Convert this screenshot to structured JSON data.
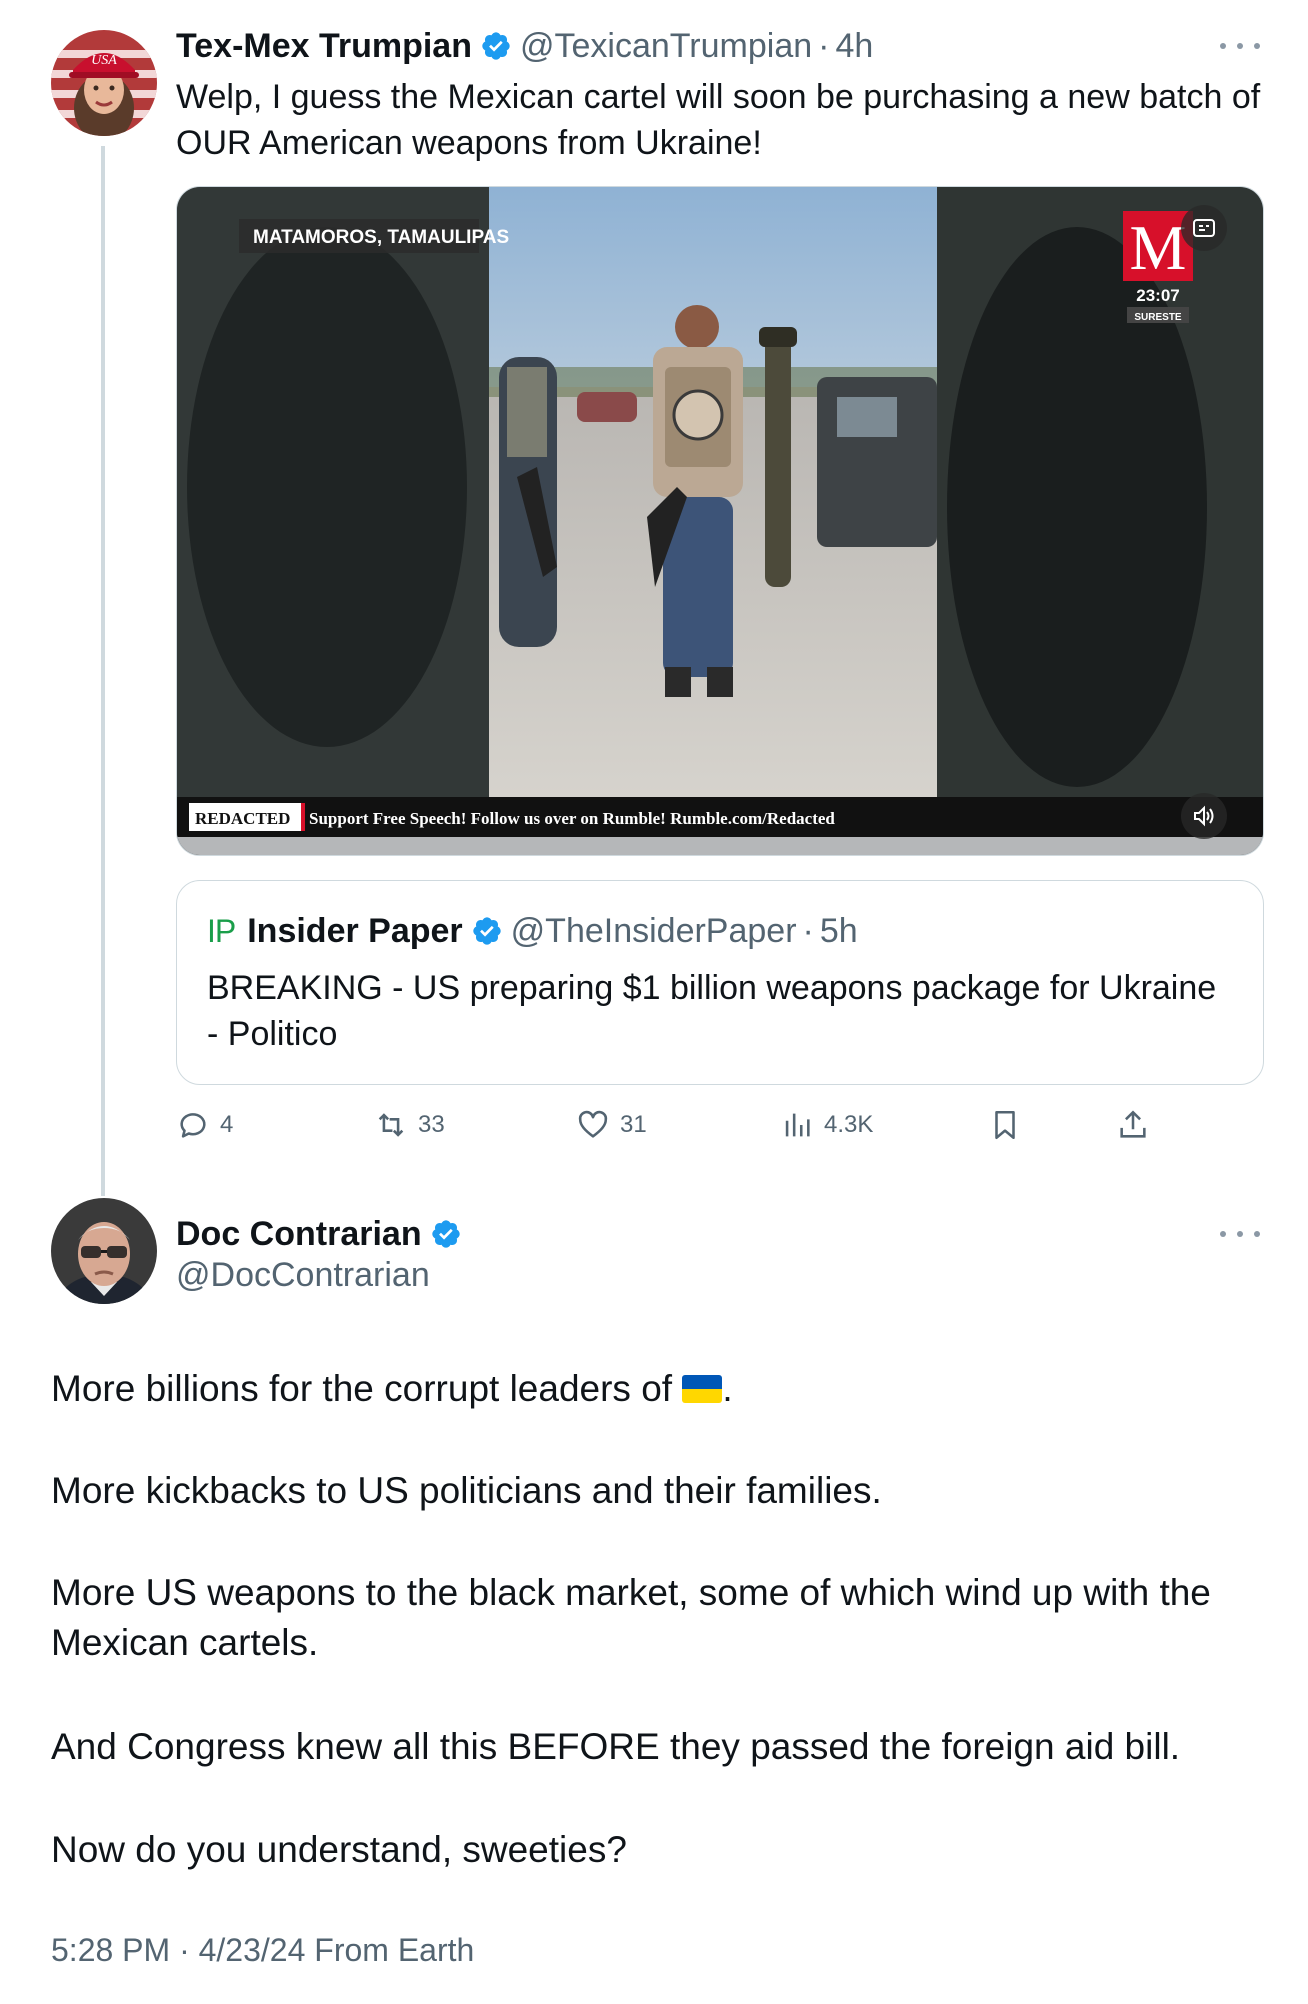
{
  "quoted_by": {
    "display_name": "Tex-Mex Trumpian",
    "handle": "@TexicanTrumpian",
    "separator": "·",
    "time": "4h",
    "text": "Welp, I guess the Mexican cartel will soon be purchasing a new batch of OUR American weapons from Ukraine!",
    "avatar_hat_text": "USA",
    "video": {
      "location_label": "MATAMOROS, TAMAULIPAS",
      "channel_logo": "M",
      "clock": "23:07",
      "channel_sub": "SURESTE",
      "ticker_brand": "REDACTED",
      "ticker_text": "Support Free Speech! Follow us over on Rumble! Rumble.com/Redacted",
      "cc_icon": "captions-icon",
      "volume_icon": "volume-icon"
    },
    "quote": {
      "logo": "IP",
      "display_name": "Insider Paper",
      "handle": "@TheInsiderPaper",
      "separator": "·",
      "time": "5h",
      "text": "BREAKING - US preparing $1 billion weapons package for Ukraine - Politico"
    },
    "actions": {
      "replies": "4",
      "reposts": "33",
      "likes": "31",
      "views": "4.3K"
    }
  },
  "main_post": {
    "display_name": "Doc Contrarian",
    "handle": "@DocContrarian",
    "paragraphs": {
      "p1_before_flag": "More billions for the corrupt leaders of ",
      "p1_after_flag": ".",
      "p2": "More kickbacks to US politicians and their families.",
      "p3": "More US weapons to the black market, some of which wind up with the Mexican cartels.",
      "p4": "And Congress knew all this BEFORE they passed the foreign aid bill.",
      "p5": "Now do you understand, sweeties?"
    },
    "meta": "5:28 PM · 4/23/24 From Earth"
  },
  "colors": {
    "text": "#0f1419",
    "secondary": "#536471",
    "verified": "#1d9bf0",
    "border": "#cfd9de"
  }
}
